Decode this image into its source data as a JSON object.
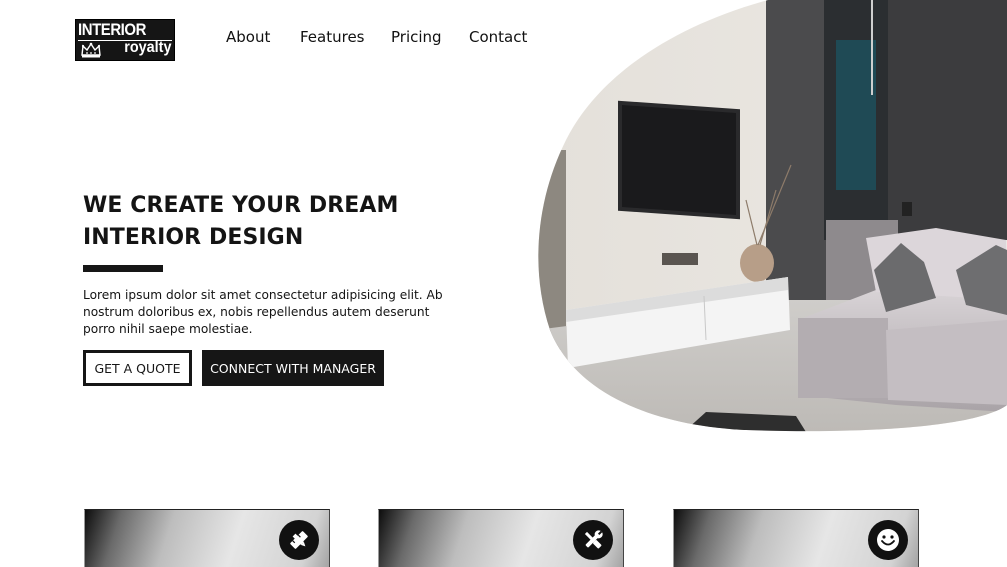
{
  "logo": {
    "line1": "INTERIOR",
    "line2": "royalty",
    "icon": "crown-icon"
  },
  "nav": {
    "items": [
      {
        "label": "About"
      },
      {
        "label": "Features"
      },
      {
        "label": "Pricing"
      },
      {
        "label": "Contact"
      }
    ]
  },
  "hero": {
    "title_line1": "WE CREATE YOUR DREAM",
    "title_line2": "INTERIOR DESIGN",
    "text": "Lorem ipsum dolor sit amet consectetur adipisicing elit. Ab nostrum doloribus ex, nobis repellendus autem deserunt porro nihil saepe molestiae.",
    "buttons": {
      "quote": "GET A QUOTE",
      "manager": "CONNECT WITH MANAGER"
    },
    "image": "living-room-photo"
  },
  "features": {
    "cards": [
      {
        "icon": "pencil-ruler-icon"
      },
      {
        "icon": "tools-icon"
      },
      {
        "icon": "smile-icon"
      }
    ]
  },
  "colors": {
    "text": "#161616",
    "accent": "#161616",
    "background": "#ffffff"
  }
}
